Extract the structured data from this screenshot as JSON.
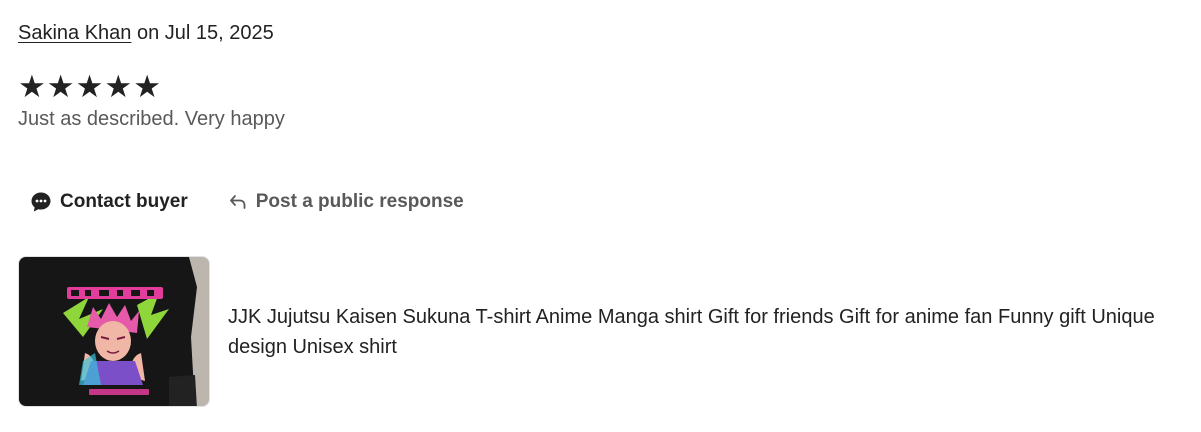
{
  "review": {
    "reviewer_name": "Sakina Khan",
    "date_text": " on Jul 15, 2025",
    "rating": 5,
    "rating_max": 5,
    "stars": [
      "★",
      "★",
      "★",
      "★",
      "★"
    ],
    "text": "Just as described. Very happy"
  },
  "actions": {
    "contact_label": "Contact buyer",
    "contact_icon": "chat-bubble-icon",
    "response_label": "Post a public response",
    "response_icon": "reply-arrow-icon"
  },
  "listing": {
    "title": "JJK Jujutsu Kaisen Sukuna T-shirt Anime Manga shirt Gift for friends Gift for anime fan Funny gift Unique design Unisex shirt",
    "image_alt": "anime t-shirt product photo"
  },
  "colors": {
    "text_primary": "#222222",
    "text_secondary": "#595959",
    "shirt": "#161616",
    "print_pink": "#e23d9a",
    "print_green": "#8fd63b"
  }
}
